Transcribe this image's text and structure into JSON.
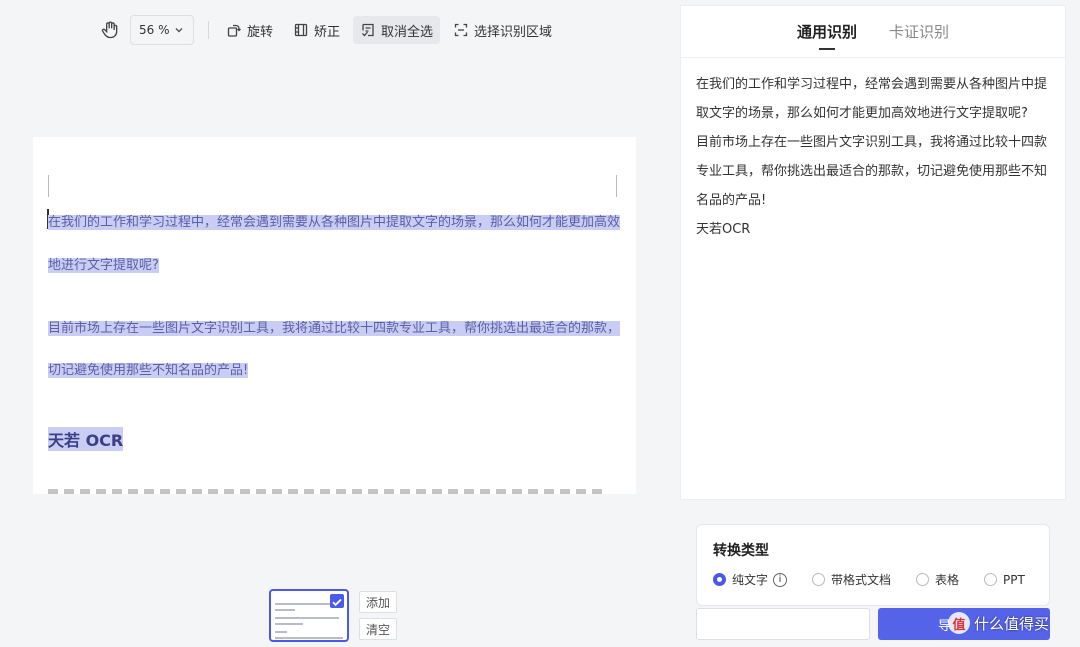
{
  "toolbar": {
    "zoom_value": "56 %",
    "rotate_label": "旋转",
    "correct_label": "矫正",
    "deselect_all_label": "取消全选",
    "select_region_label": "选择识别区域"
  },
  "document": {
    "line1": "在我们的工作和学习过程中，经常会遇到需要从各种图片中提取文字的场景，那么如何才能更加高效",
    "line2": "地进行文字提取呢?",
    "line3": "目前市场上存在一些图片文字识别工具，我将通过比较十四款专业工具，帮你挑选出最适合的那款，",
    "line4": "切记避免使用那些不知名品的产品!",
    "heading": "天若 OCR"
  },
  "thumbnail_panel": {
    "add_label": "添加",
    "clear_label": "清空"
  },
  "panel": {
    "tabs": [
      {
        "label": "通用识别"
      },
      {
        "label": "卡证识别"
      }
    ],
    "result_paragraphs": [
      "在我们的工作和学习过程中，经常会遇到需要从各种图片中提取文字的场景，那么如何才能更加高效地进行文字提取呢?",
      "目前市场上存在一些图片文字识别工具，我将通过比较十四款专业工具，帮你挑选出最适合的那款，切记避免使用那些不知名品的产品!",
      "天若OCR"
    ]
  },
  "conversion": {
    "title": "转换类型",
    "options": [
      {
        "label": "纯文字",
        "selected": true
      },
      {
        "label": "带格式文档",
        "selected": false
      },
      {
        "label": "表格",
        "selected": false
      },
      {
        "label": "PPT",
        "selected": false
      }
    ]
  },
  "export": {
    "button_label": "导"
  },
  "watermark": {
    "badge": "值",
    "text": "什么值得买"
  },
  "colors": {
    "accent": "#4a5ae8",
    "selection": "#c9cdf3"
  }
}
